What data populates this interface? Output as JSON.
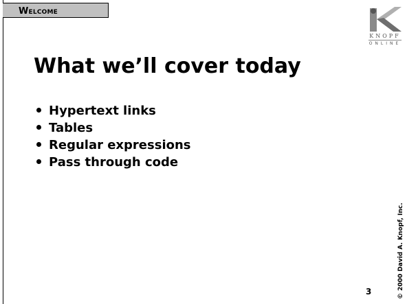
{
  "section": {
    "label": "Welcome"
  },
  "logo": {
    "wordmark_top": "KNOPF",
    "wordmark_bottom": "ONLINE"
  },
  "slide": {
    "title": "What we’ll cover today",
    "bullets": [
      "Hypertext links",
      "Tables",
      "Regular expressions",
      "Pass through code"
    ],
    "number": "3",
    "copyright": "© 2000 David A. Knopf, Inc."
  },
  "colors": {
    "tab_fill": "#c0c0c0",
    "text": "#000000"
  }
}
